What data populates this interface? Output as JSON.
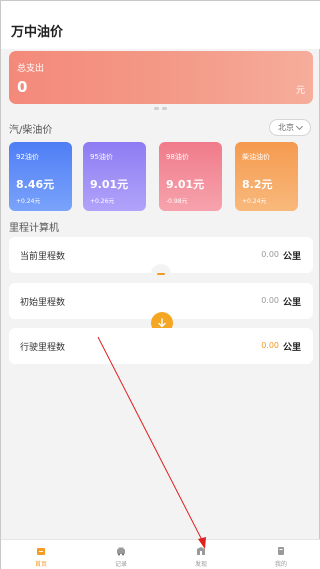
{
  "header": {
    "title": "万中油价"
  },
  "expense": {
    "label": "总支出",
    "value": "0",
    "unit": "元"
  },
  "oil_section": {
    "title": "汽/柴油价",
    "city": "北京"
  },
  "oil_cards": [
    {
      "name": "92油价",
      "price": "8.46元",
      "change": "+0.24元",
      "color_start": "#4f7ef5",
      "color_end": "#7aa3fb"
    },
    {
      "name": "95油价",
      "price": "9.01元",
      "change": "+0.26元",
      "color_start": "#8d7cf3",
      "color_end": "#b1a3fa"
    },
    {
      "name": "98油价",
      "price": "9.01元",
      "change": "-0.98元",
      "color_start": "#f07b8a",
      "color_end": "#f6a3ad"
    },
    {
      "name": "柴油油价",
      "price": "8.2元",
      "change": "+0.24元",
      "color_start": "#f59a4f",
      "color_end": "#f8b97c"
    }
  ],
  "mileage": {
    "title": "里程计算机",
    "rows": [
      {
        "label": "当前里程数",
        "value": "0.00",
        "unit": "公里"
      },
      {
        "label": "初始里程数",
        "value": "0.00",
        "unit": "公里"
      },
      {
        "label": "行驶里程数",
        "value": "0.00",
        "unit": "公里"
      }
    ]
  },
  "tabs": [
    {
      "label": "首页",
      "icon": "home-icon",
      "active": true
    },
    {
      "label": "记录",
      "icon": "car-icon",
      "active": false
    },
    {
      "label": "发现",
      "icon": "discover-icon",
      "active": false
    },
    {
      "label": "我的",
      "icon": "profile-icon",
      "active": false
    }
  ],
  "colors": {
    "accent": "#f59a23",
    "annotation": "#e02020"
  }
}
